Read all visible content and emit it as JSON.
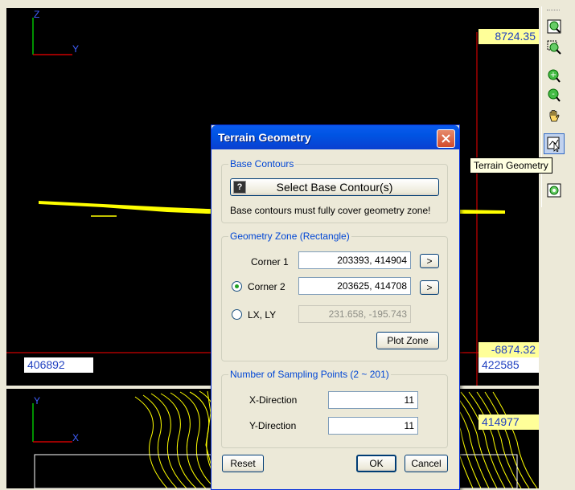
{
  "top_view": {
    "axis_z": "Z",
    "axis_y": "Y",
    "coord_top_right": "8724.35",
    "coord_bottom_right_upper": "-6874.32",
    "coord_bottom_left": "406892",
    "coord_bottom_right_lower": "422585"
  },
  "bottom_view": {
    "axis_y": "Y",
    "axis_x": "X",
    "coord_right": "414977"
  },
  "toolbar": {
    "tooltip": "Terrain Geometry",
    "tools": [
      "zoom-extents-icon",
      "zoom-window-icon",
      "zoom-in-icon",
      "zoom-out-icon",
      "pan-hand-icon",
      "terrain-geometry-icon",
      "view-3d-icon"
    ]
  },
  "dialog": {
    "title": "Terrain Geometry",
    "base_contours": {
      "group_title": "Base Contours",
      "select_button": "Select Base Contour(s)",
      "note": "Base contours must fully cover geometry zone!"
    },
    "geometry_zone": {
      "group_title": "Geometry Zone (Rectangle)",
      "corner1_label": "Corner 1",
      "corner1_value": "203393, 414904",
      "corner2_label": "Corner 2",
      "corner2_value": "203625, 414708",
      "lxly_label": "LX, LY",
      "lxly_value": "231.658, -195.743",
      "pick_button": ">",
      "plot_zone_button": "Plot Zone"
    },
    "sampling": {
      "group_title": "Number of Sampling Points (2 ~ 201)",
      "x_label": "X-Direction",
      "x_value": "11",
      "y_label": "Y-Direction",
      "y_value": "11"
    },
    "reset_button": "Reset",
    "ok_button": "OK",
    "cancel_button": "Cancel"
  },
  "colors": {
    "viewport_bg": "#000000",
    "terrain": "#ffff00",
    "axis_red": "#cc0000",
    "axis_green": "#00c000",
    "titlebar": "#0054e3",
    "group_title": "#0046d5"
  }
}
